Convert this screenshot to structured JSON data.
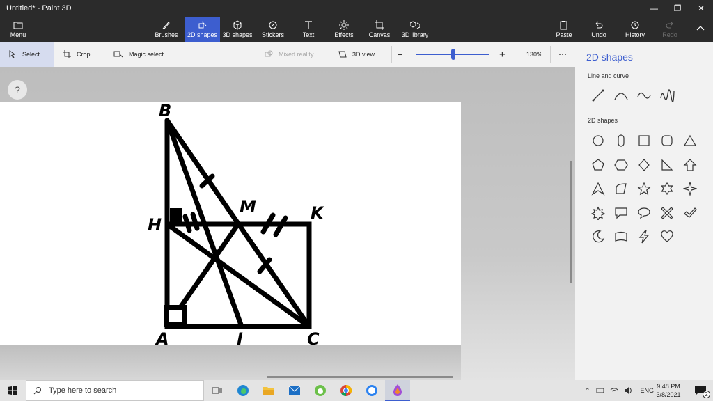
{
  "window": {
    "title": "Untitled* - Paint 3D"
  },
  "ribbon": {
    "menu": "Menu",
    "tabs": [
      "Brushes",
      "2D shapes",
      "3D shapes",
      "Stickers",
      "Text",
      "Effects",
      "Canvas",
      "3D library"
    ],
    "active_tab": "2D shapes",
    "paste": "Paste",
    "undo": "Undo",
    "history": "History",
    "redo": "Redo"
  },
  "toolbar": {
    "select": "Select",
    "crop": "Crop",
    "magic_select": "Magic select",
    "mixed_reality": "Mixed reality",
    "view_3d": "3D view",
    "zoom": "130%",
    "zoom_level": 0.51
  },
  "workspace": {
    "help": "?"
  },
  "drawing": {
    "labels": {
      "B": "B",
      "H": "H",
      "M": "M",
      "K": "K",
      "A": "A",
      "I": "I",
      "C": "C"
    }
  },
  "panel": {
    "title": "2D shapes",
    "line_curve_heading": "Line and curve",
    "shapes_heading": "2D shapes"
  },
  "taskbar": {
    "search_placeholder": "Type here to search",
    "language": "ENG",
    "time": "9:48 PM",
    "date": "3/8/2021",
    "notifications": "2"
  },
  "colors": {
    "accent": "#3d5ecf",
    "titlebar": "#2b2b2b",
    "panel": "#f2f2f2"
  }
}
